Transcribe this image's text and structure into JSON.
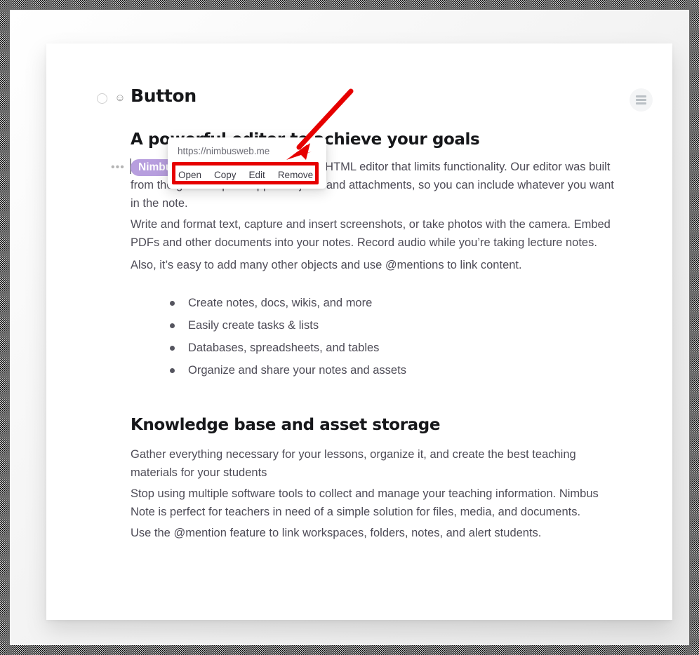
{
  "document": {
    "top_block": {
      "checkbox_state": "unchecked",
      "emoji": "☺",
      "heading": "Button"
    },
    "menu_button": {
      "icon": "hamburger-icon"
    },
    "main_heading": "A powerful editor to achieve your goals",
    "paragraph_1": {
      "mention": "Nimbus Note",
      "text": " doesn’t use a simple HTML editor that limits functionality. Our editor was built from the ground up to support objects and attachments, so you can include whatever you want in the note."
    },
    "paragraph_2": "Write and format text, capture and insert screenshots, or take photos with the camera. Embed PDFs and other documents into your notes. Record audio while you’re taking lecture notes.",
    "paragraph_3": "Also, it’s easy to add many other objects and use @mentions to link content.",
    "bullets": [
      "Create notes, docs, wikis, and more",
      "Easily create tasks & lists",
      "Databases, spreadsheets, and tables",
      "Organize and share your notes and assets"
    ],
    "section_heading": "Knowledge base and asset storage",
    "section_paragraph_1": "Gather everything necessary for your lessons, organize it, and create the best teaching materials for your students",
    "section_paragraph_2": "Stop using multiple software tools to collect and manage your teaching information. Nimbus Note is perfect for teachers in need of a simple solution for files, media, and documents.",
    "section_paragraph_3": "Use the @mention feature to link workspaces, folders, notes, and alert students.",
    "drag_handle": "•••"
  },
  "link_popup": {
    "url": "https://nimbusweb.me",
    "actions": [
      {
        "label": "Open"
      },
      {
        "label": "Copy"
      },
      {
        "label": "Edit"
      },
      {
        "label": "Remove"
      }
    ]
  },
  "annotations": {
    "highlight_color": "#e60000",
    "arrow_color": "#e60000"
  },
  "colors": {
    "mention_badge": "#b79ede",
    "body_text": "#4e4c57",
    "heading_text": "#16171a",
    "card_background": "#ffffff"
  }
}
